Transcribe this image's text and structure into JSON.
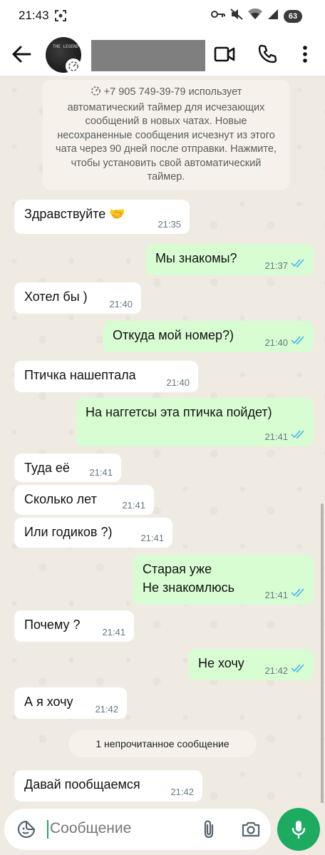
{
  "status_bar": {
    "time": "21:43",
    "battery": "63"
  },
  "app_bar": {
    "avatar_text": "THE LEGEND",
    "icons": [
      "back-arrow-icon",
      "timer-icon",
      "video-call-icon",
      "phone-icon",
      "more-vert-icon"
    ]
  },
  "system_notice": {
    "text": "+7 905 749-39-79 использует автоматический таймер для исчезающих сообщений в новых чатах. Новые несохраненные сообщения исчезнут из этого чата через 90 дней после отправки. Нажмите, чтобы установить свой автоматический таймер."
  },
  "messages": [
    {
      "dir": "in",
      "text": "Здравствуйте 🤝",
      "time": "21:35"
    },
    {
      "dir": "out",
      "text": "Мы знакомы?",
      "time": "21:37"
    },
    {
      "dir": "in",
      "text": "Хотел бы )",
      "time": "21:40"
    },
    {
      "dir": "out",
      "text": "Откуда мой номер?)",
      "time": "21:40"
    },
    {
      "dir": "in",
      "text": "Птичка нашептала",
      "time": "21:40"
    },
    {
      "dir": "out",
      "text": "На наггетсы эта птичка пойдет)",
      "time": "21:41"
    },
    {
      "dir": "in",
      "text": "Туда её",
      "time": "21:41"
    },
    {
      "dir": "in",
      "text": "Сколько лет",
      "time": "21:41"
    },
    {
      "dir": "in",
      "text": "Или годиков ?)",
      "time": "21:41"
    },
    {
      "dir": "out",
      "text": "Старая уже",
      "text2": "Не знакомлюсь",
      "time": "21:41"
    },
    {
      "dir": "in",
      "text": "Почему ?",
      "time": "21:41"
    },
    {
      "dir": "out",
      "text": "Не хочу",
      "time": "21:42"
    },
    {
      "dir": "in",
      "text": "А я хочу",
      "time": "21:42"
    },
    {
      "dir": "in",
      "text": "Давай пообщаемся",
      "time": "21:42"
    }
  ],
  "unread_divider": "1 непрочитанное сообщение",
  "composer": {
    "placeholder": "Сообщение"
  },
  "colors": {
    "accent": "#1daa61",
    "outgoing_bubble": "#d9fdd3",
    "incoming_bubble": "#ffffff",
    "read_ticks": "#53bdeb"
  }
}
